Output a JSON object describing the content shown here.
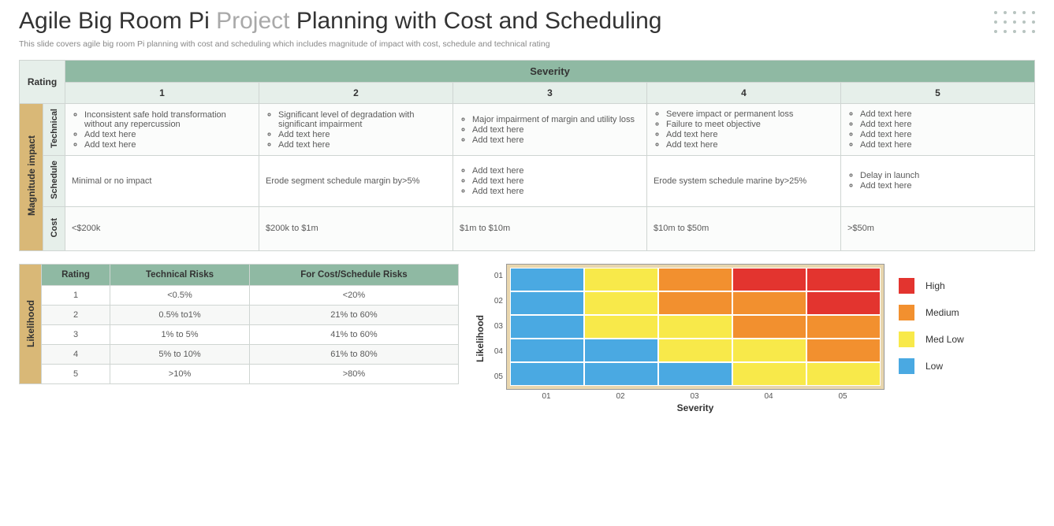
{
  "title_pre": "Agile Big Room Pi ",
  "title_accent": "Project",
  "title_post": " Planning with Cost and Scheduling",
  "subtitle": "This slide covers agile big room Pi planning with cost and scheduling which includes magnitude of impact with cost, schedule and technical rating",
  "main": {
    "severity_header": "Severity",
    "rating_header": "Rating",
    "vlabel": "Magnitude impact",
    "cols": [
      "1",
      "2",
      "3",
      "4",
      "5"
    ],
    "rows": [
      {
        "label": "Technical",
        "type": "list",
        "cells": [
          [
            "Inconsistent safe hold transformation without any repercussion",
            "Add text here",
            "Add text here"
          ],
          [
            "Significant level of degradation with significant impairment",
            "Add text here",
            "Add text here"
          ],
          [
            "Major impairment of margin and utility loss",
            "Add text here",
            "Add text here"
          ],
          [
            "Severe impact or permanent loss",
            "Failure to meet objective",
            "Add text here",
            "Add text here"
          ],
          [
            "Add text here",
            "Add text here",
            "Add text here",
            "Add text here"
          ]
        ]
      },
      {
        "label": "Schedule",
        "type": "mixed",
        "cells": [
          {
            "plain": "Minimal or no impact"
          },
          {
            "plain": "Erode segment schedule margin by>5%"
          },
          {
            "list": [
              "Add text here",
              "Add text here",
              "Add text here"
            ]
          },
          {
            "plain": "Erode system schedule marine by>25%"
          },
          {
            "list": [
              "Delay in launch",
              "Add text here"
            ]
          }
        ]
      },
      {
        "label": "Cost",
        "type": "plain",
        "cells": [
          "<$200k",
          "$200k to $1m",
          "$1m to $10m",
          "$10m to $50m",
          ">$50m"
        ]
      }
    ]
  },
  "likelihood": {
    "vlabel": "Likelihood",
    "headers": [
      "Rating",
      "Technical Risks",
      "For Cost/Schedule Risks"
    ],
    "rows": [
      [
        "1",
        "<0.5%",
        "<20%"
      ],
      [
        "2",
        "0.5% to1%",
        "21% to 60%"
      ],
      [
        "3",
        "1% to 5%",
        "41% to 60%"
      ],
      [
        "4",
        "5% to 10%",
        "61% to 80%"
      ],
      [
        "5",
        ">10%",
        ">80%"
      ]
    ]
  },
  "chart_data": {
    "type": "heatmap",
    "xlabel": "Severity",
    "ylabel": "Likelihood",
    "x_ticks": [
      "01",
      "02",
      "03",
      "04",
      "05"
    ],
    "y_ticks": [
      "01",
      "02",
      "03",
      "04",
      "05"
    ],
    "levels": {
      "0": "Low",
      "1": "Med Low",
      "2": "Medium",
      "3": "High"
    },
    "colors": {
      "Low": "#4aa9e2",
      "Med Low": "#f8e94a",
      "Medium": "#f2902f",
      "High": "#e3342f"
    },
    "grid": [
      [
        0,
        1,
        2,
        3,
        3
      ],
      [
        0,
        1,
        2,
        2,
        3
      ],
      [
        0,
        1,
        1,
        2,
        2
      ],
      [
        0,
        0,
        1,
        1,
        2
      ],
      [
        0,
        0,
        0,
        1,
        1
      ]
    ],
    "legend": [
      "High",
      "Medium",
      "Med Low",
      "Low"
    ]
  }
}
